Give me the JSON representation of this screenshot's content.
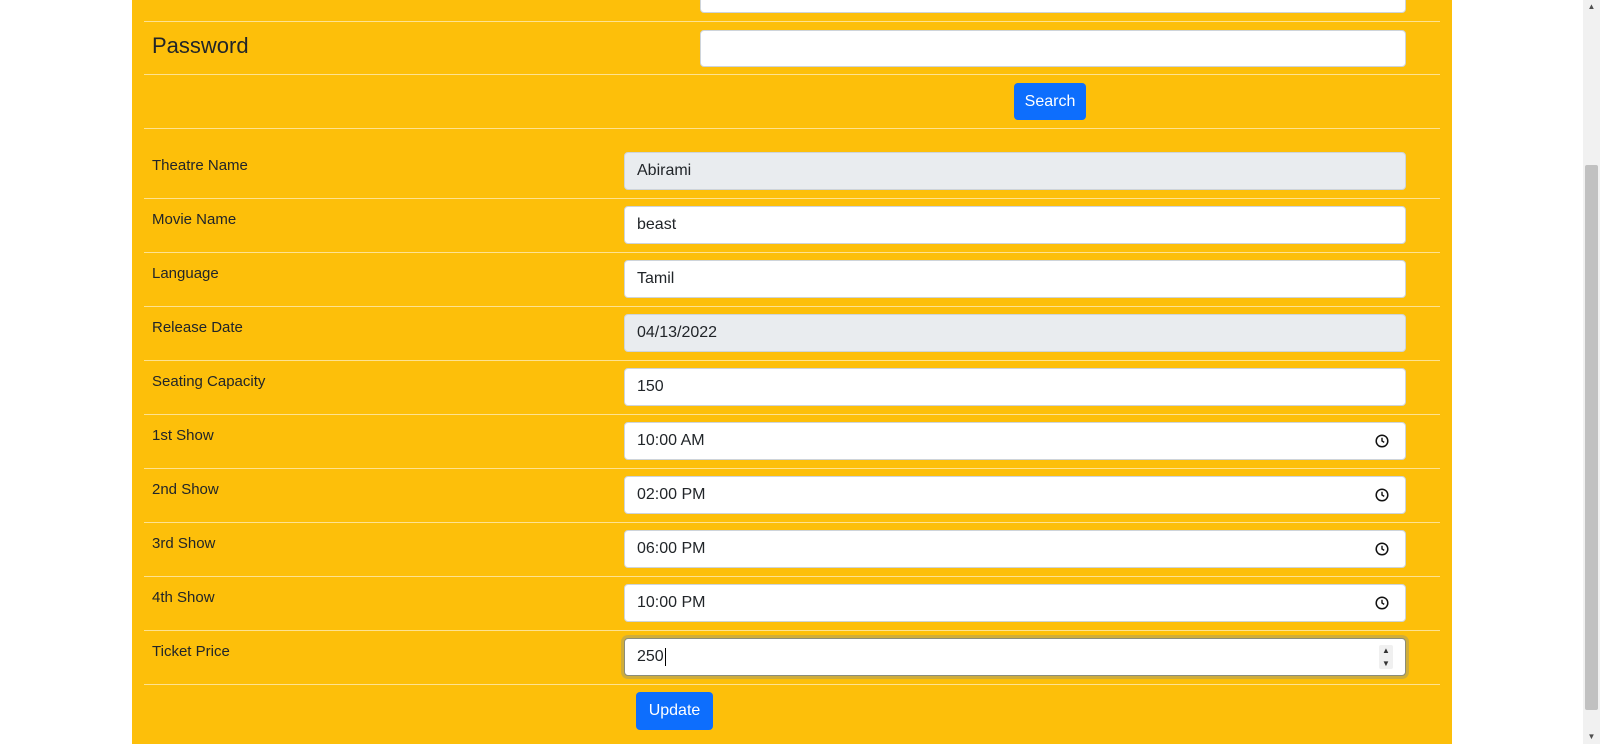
{
  "form": {
    "password_label": "Password",
    "password_value": "",
    "search_label": "Search",
    "update_label": "Update",
    "fields": [
      {
        "label": "Theatre Name",
        "value": "Abirami"
      },
      {
        "label": "Movie Name",
        "value": "beast"
      },
      {
        "label": "Language",
        "value": "Tamil"
      },
      {
        "label": "Release Date",
        "value": "04/13/2022"
      },
      {
        "label": "Seating Capacity",
        "value": "150"
      },
      {
        "label": "1st Show",
        "value": "10:00 AM"
      },
      {
        "label": "2nd Show",
        "value": "02:00 PM"
      },
      {
        "label": "3rd Show",
        "value": "06:00 PM"
      },
      {
        "label": "4th Show",
        "value": "10:00 PM"
      },
      {
        "label": "Ticket Price",
        "value": "250"
      }
    ]
  },
  "colors": {
    "panel_background": "#fdbf0a",
    "button_primary": "#0d6efd",
    "readonly_field": "#e9ecef"
  },
  "icons": {
    "time_field": "clock-icon",
    "number_field": "spinner-icon"
  }
}
